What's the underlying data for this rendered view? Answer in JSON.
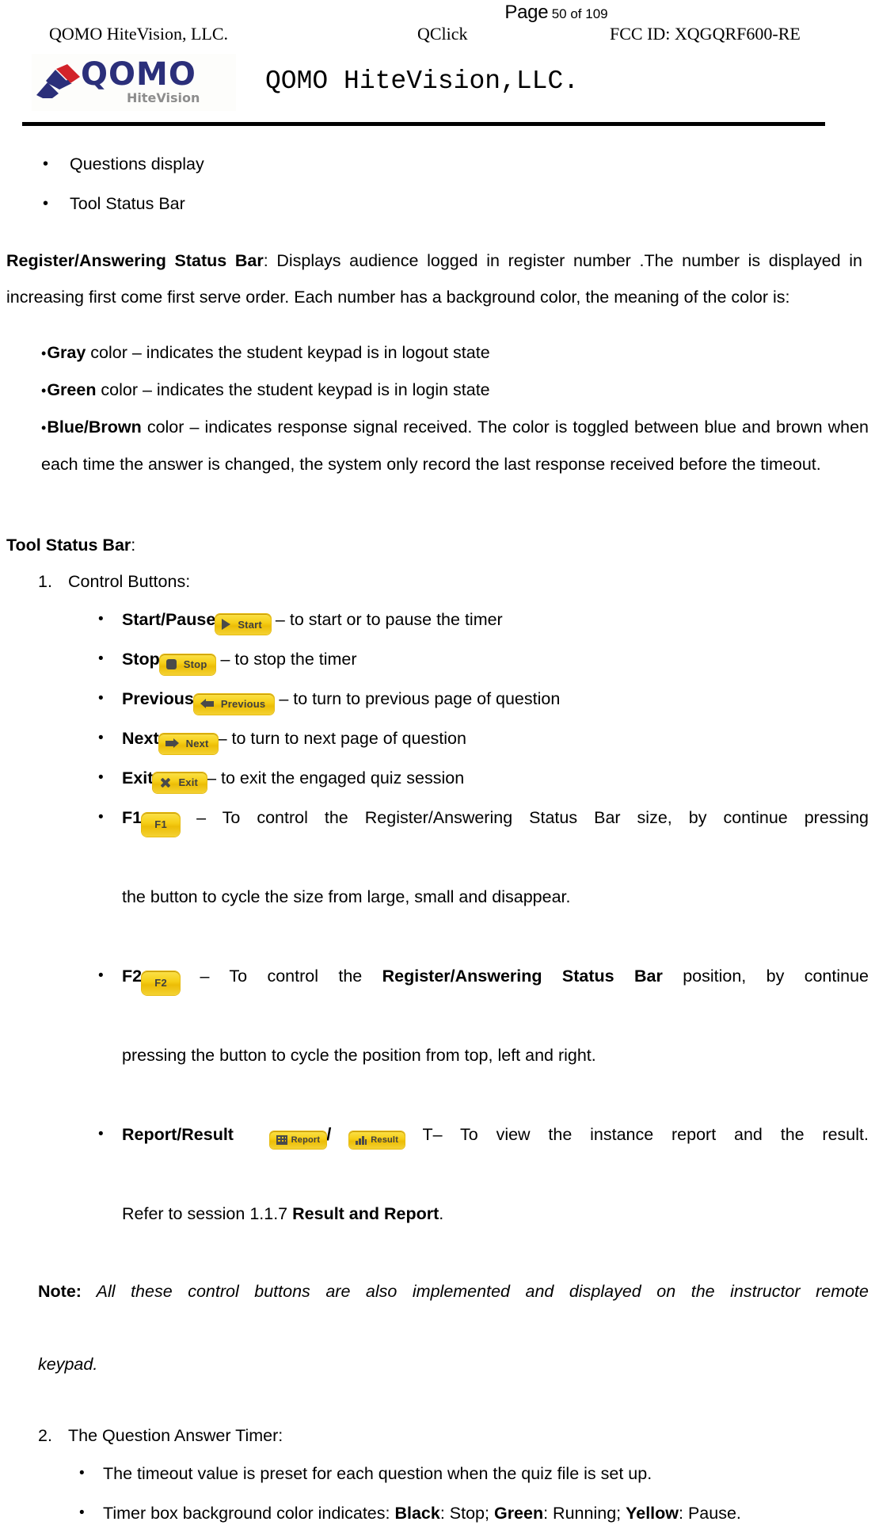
{
  "header": {
    "page_word": "Page",
    "page_number_text": "50 of 109",
    "company": "QOMO HiteVision, LLC.",
    "product": "QClick",
    "fcc": "FCC ID: XQGQRF600-RE",
    "logo_mark": "qomo-chevron-logo",
    "logo_wordmark": "QOMO",
    "logo_subtext": "HiteVision",
    "title": "QOMO HiteVision,LLC."
  },
  "body": {
    "bullets_top": [
      "Questions display",
      "Tool Status Bar"
    ],
    "register_bar": {
      "term": "Register/Answering Status Bar",
      "text": ": Displays audience logged in register number .The number is displayed in increasing first come first serve order. Each number has a background color, the meaning of the color is:"
    },
    "color_bullets": [
      {
        "term": "Gray",
        "text": " color – indicates the student keypad is in logout state"
      },
      {
        "term": "Green",
        "text": " color – indicates the student keypad is in login state"
      },
      {
        "term": "Blue/Brown",
        "text": " color – indicates response signal received. The color is toggled between blue and brown when each time the answer is changed, the system only record the last response received before the timeout."
      }
    ],
    "tool_status_bar_heading": "Tool Status Bar",
    "tool_status_bar_colon": ":",
    "section1": {
      "number": "1.",
      "title": "Control Buttons:",
      "items": [
        {
          "term": "Start/Pause",
          "button": {
            "label": "Start",
            "icon": "play-icon",
            "kind": "wide"
          },
          "text": " – to start or to pause the timer"
        },
        {
          "term": "Stop",
          "button": {
            "label": "Stop",
            "icon": "stop-square-icon",
            "kind": "wide"
          },
          "text": " – to stop the timer"
        },
        {
          "term": "Previous",
          "button": {
            "label": "Previous",
            "icon": "arrow-left-icon",
            "kind": "wide"
          },
          "text": " – to turn to previous page of question"
        },
        {
          "term": "Next",
          "button": {
            "label": "Next",
            "icon": "arrow-right-icon",
            "kind": "wide"
          },
          "text": "– to turn to next page of question"
        },
        {
          "term": "Exit",
          "button": {
            "label": "Exit",
            "icon": "close-x-icon",
            "kind": "wide"
          },
          "text": "– to exit the engaged quiz session"
        }
      ],
      "f1": {
        "term": "F1",
        "button": {
          "label": "F1",
          "icon": "none",
          "kind": "square"
        },
        "text_pre": " – To control the Register/Answering Status Bar size, by continue pressing ",
        "text_cont": "the button to cycle the size from large, small and disappear."
      },
      "f2": {
        "term": "F2",
        "button": {
          "label": "F2",
          "icon": "none",
          "kind": "square"
        },
        "text_a": " – To control the ",
        "bold_b": "Register/Answering Status Bar",
        "text_c": " position, by continue ",
        "text_cont": "pressing the button to cycle the position from top, left and right."
      },
      "report_result": {
        "term": "Report/Result",
        "button_report": {
          "label": "Report",
          "icon": "grid-table-icon",
          "kind": "small"
        },
        "separator": "/",
        "button_result": {
          "label": "Result",
          "icon": "bar-chart-icon",
          "kind": "small"
        },
        "text": " T– To view the instance report and the result. ",
        "text_cont_a": "Refer to session 1.1.7 ",
        "text_cont_bold": "Result and Report",
        "text_cont_b": "."
      }
    },
    "note": {
      "label": "Note:",
      "text": " All these control buttons are also implemented and displayed on the instructor remote ",
      "text_cont": "keypad."
    },
    "section2": {
      "number": "2.",
      "title": "The Question Answer Timer:",
      "items": [
        {
          "text": "The timeout value is preset for each question when the quiz file is set up."
        }
      ],
      "timer_colors": {
        "prefix": "Timer box background color indicates: ",
        "black_label": "Black",
        "black_text": ": Stop; ",
        "green_label": "Green",
        "green_text": ": Running; ",
        "yellow_label": "Yellow",
        "yellow_text": ": Pause."
      }
    }
  },
  "colors": {
    "button_gold": "#F5CE1A",
    "button_icon_gray": "#4A4A4A",
    "logo_navy": "#2B2F7A",
    "logo_red": "#D2232A",
    "logo_gray": "#8D8D8D",
    "rule_black": "#000000"
  }
}
